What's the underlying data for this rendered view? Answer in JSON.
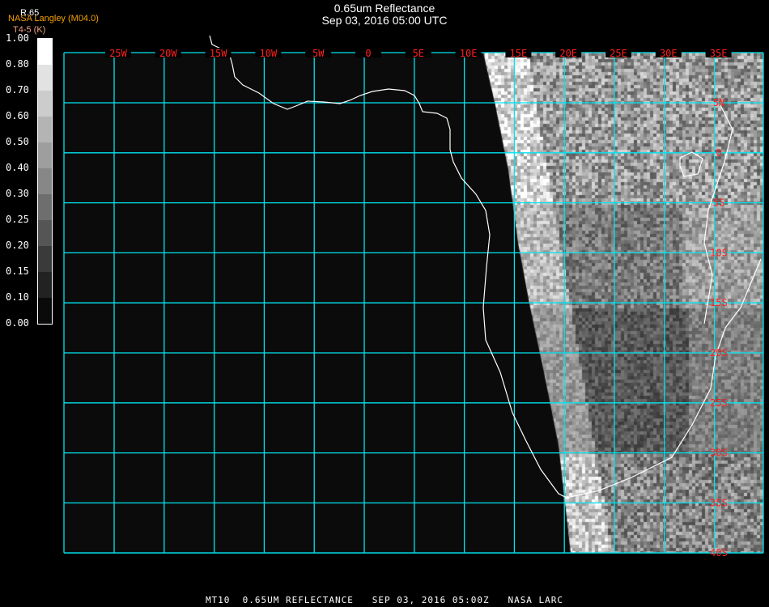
{
  "header": {
    "title": "0.65um Reflectance",
    "subtitle": "Sep 03, 2016 05:00 UTC"
  },
  "colorbar": {
    "variable": "R.65",
    "source": "NASA Langley (M04.0)",
    "unit": "T4-5 (K)",
    "labels": [
      "0.00",
      "0.10",
      "0.15",
      "0.20",
      "0.25",
      "0.30",
      "0.40",
      "0.50",
      "0.60",
      "0.70",
      "0.80",
      "1.00"
    ],
    "bin_colors": [
      "#0a0a0a",
      "#222222",
      "#3a3a3a",
      "#555555",
      "#6e6e6e",
      "#878787",
      "#9e9e9e",
      "#b4b4b4",
      "#cccccc",
      "#e2e2e2",
      "#ffffff"
    ]
  },
  "map": {
    "longitude_labels": [
      "25W",
      "20W",
      "15W",
      "10W",
      "5W",
      "0",
      "5E",
      "10E",
      "15E",
      "20E",
      "25E",
      "30E",
      "35E"
    ],
    "latitude_labels": [
      "5N",
      "0",
      "5S",
      "10S",
      "15S",
      "20S",
      "25S",
      "30S",
      "35S",
      "40S"
    ],
    "grid_color": "#00e5f0",
    "label_color": "#ff2020",
    "coastline_color": "#ffffff",
    "background_color": "#0b0b0b"
  },
  "footer": {
    "text": "MT10  0.65UM REFLECTANCE   SEP 03, 2016 05:00Z   NASA LARC"
  }
}
